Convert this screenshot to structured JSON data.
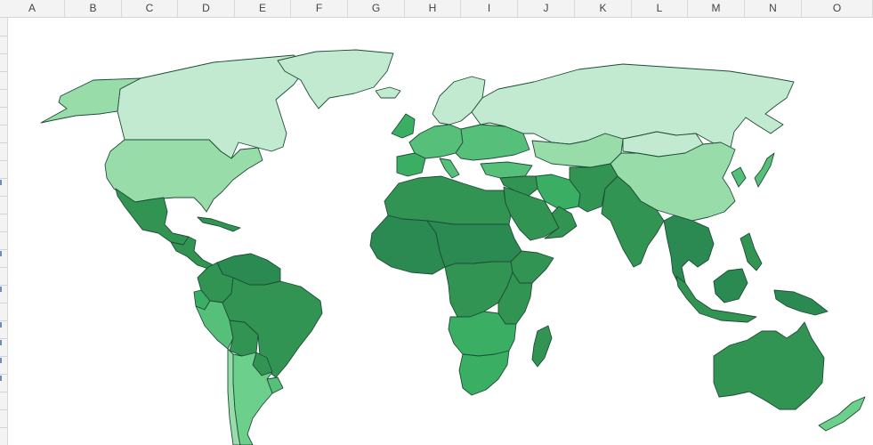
{
  "columns": [
    "A",
    "B",
    "C",
    "D",
    "E",
    "F",
    "G",
    "H",
    "I",
    "J",
    "K",
    "L",
    "M",
    "N",
    "O"
  ],
  "map": {
    "type": "filled world map",
    "colors": {
      "darkest": "#2a8a52",
      "dark": "#329453",
      "medium": "#3aae63",
      "mediumlight": "#56c07a",
      "light": "#6ccf8c",
      "pale": "#98dcaa",
      "palest": "#c2ead0",
      "border": "#1e4d35"
    },
    "regions": [
      {
        "name": "canada",
        "shade": "palest"
      },
      {
        "name": "alaska",
        "shade": "pale"
      },
      {
        "name": "greenland",
        "shade": "palest"
      },
      {
        "name": "usa",
        "shade": "pale"
      },
      {
        "name": "mexico",
        "shade": "dark"
      },
      {
        "name": "central-america",
        "shade": "dark"
      },
      {
        "name": "caribbean",
        "shade": "dark"
      },
      {
        "name": "venezuela-guianas",
        "shade": "darkest"
      },
      {
        "name": "colombia",
        "shade": "dark"
      },
      {
        "name": "ecuador",
        "shade": "medium"
      },
      {
        "name": "peru",
        "shade": "mediumlight"
      },
      {
        "name": "bolivia",
        "shade": "dark"
      },
      {
        "name": "brazil",
        "shade": "dark"
      },
      {
        "name": "paraguay",
        "shade": "dark"
      },
      {
        "name": "uruguay",
        "shade": "mediumlight"
      },
      {
        "name": "chile",
        "shade": "pale"
      },
      {
        "name": "argentina",
        "shade": "light"
      },
      {
        "name": "iceland",
        "shade": "palest"
      },
      {
        "name": "uk-ireland",
        "shade": "medium"
      },
      {
        "name": "scandinavia",
        "shade": "palest"
      },
      {
        "name": "western-europe",
        "shade": "mediumlight"
      },
      {
        "name": "iberia",
        "shade": "medium"
      },
      {
        "name": "italy",
        "shade": "mediumlight"
      },
      {
        "name": "eastern-europe",
        "shade": "mediumlight"
      },
      {
        "name": "turkey",
        "shade": "mediumlight"
      },
      {
        "name": "russia",
        "shade": "palest"
      },
      {
        "name": "kazakhstan-central-asia",
        "shade": "pale"
      },
      {
        "name": "mongolia",
        "shade": "palest"
      },
      {
        "name": "china",
        "shade": "pale"
      },
      {
        "name": "korea",
        "shade": "mediumlight"
      },
      {
        "name": "japan",
        "shade": "mediumlight"
      },
      {
        "name": "iran",
        "shade": "medium"
      },
      {
        "name": "afghanistan-pakistan",
        "shade": "dark"
      },
      {
        "name": "middle-east",
        "shade": "dark"
      },
      {
        "name": "saudi-arabia",
        "shade": "dark"
      },
      {
        "name": "yemen-oman",
        "shade": "dark"
      },
      {
        "name": "india",
        "shade": "dark"
      },
      {
        "name": "southeast-asia-mainland",
        "shade": "darkest"
      },
      {
        "name": "malay-indonesia",
        "shade": "dark"
      },
      {
        "name": "borneo",
        "shade": "darkest"
      },
      {
        "name": "philippines",
        "shade": "dark"
      },
      {
        "name": "new-guinea",
        "shade": "darkest"
      },
      {
        "name": "north-africa",
        "shade": "dark"
      },
      {
        "name": "west-africa",
        "shade": "darkest"
      },
      {
        "name": "sahel-sudan",
        "shade": "darkest"
      },
      {
        "name": "horn-of-africa",
        "shade": "dark"
      },
      {
        "name": "central-africa",
        "shade": "dark"
      },
      {
        "name": "east-africa",
        "shade": "dark"
      },
      {
        "name": "southern-africa",
        "shade": "medium"
      },
      {
        "name": "south-africa",
        "shade": "medium"
      },
      {
        "name": "madagascar",
        "shade": "dark"
      },
      {
        "name": "australia",
        "shade": "dark"
      },
      {
        "name": "new-zealand",
        "shade": "light"
      }
    ]
  }
}
